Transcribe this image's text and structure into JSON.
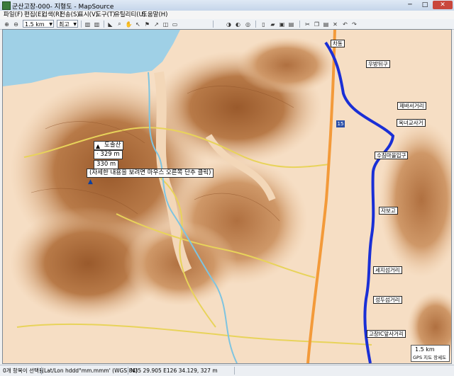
{
  "window": {
    "title": "군산고장-000- 지형도 - MapSource",
    "min": "─",
    "max": "□",
    "close": "✕"
  },
  "menu": [
    "파일(F)",
    "편집(E)",
    "검색(R)",
    "전송(S)",
    "표시(V)",
    "도구(T)",
    "유틸리티(U)",
    "도움말(H)"
  ],
  "toolbar": {
    "zoom_value": "1.5 km",
    "detail_value": "최고"
  },
  "map": {
    "tooltip": {
      "name": "도솔산",
      "elev": "329 m",
      "elev2": "330 m",
      "hint": "(자세한 내용을 보려면 마우스 오른쪽 단추 클릭)"
    },
    "waypoints": [
      "차동",
      "우방뒤구",
      "제바서거리",
      "옥녀교사거",
      "수침마을입구",
      "자보고",
      "세지섬거리",
      "성두섬거리",
      "고창IC앞사거리"
    ],
    "road_shield": "15",
    "scale_label": "1.5 km",
    "map_credit": "GPS 지도 장세도"
  },
  "status": {
    "selection": "0개 항목이 선택됨",
    "format": "Lat/Lon hddd°mm.mmm' (WGS 84)",
    "coords": "N35 29.905 E126 34.129, 327 m"
  },
  "colors": {
    "terrain_low": "#f5dcc0",
    "terrain_high": "#a0602f",
    "route": "#1a2fd6",
    "highway": "#f39a3a"
  }
}
